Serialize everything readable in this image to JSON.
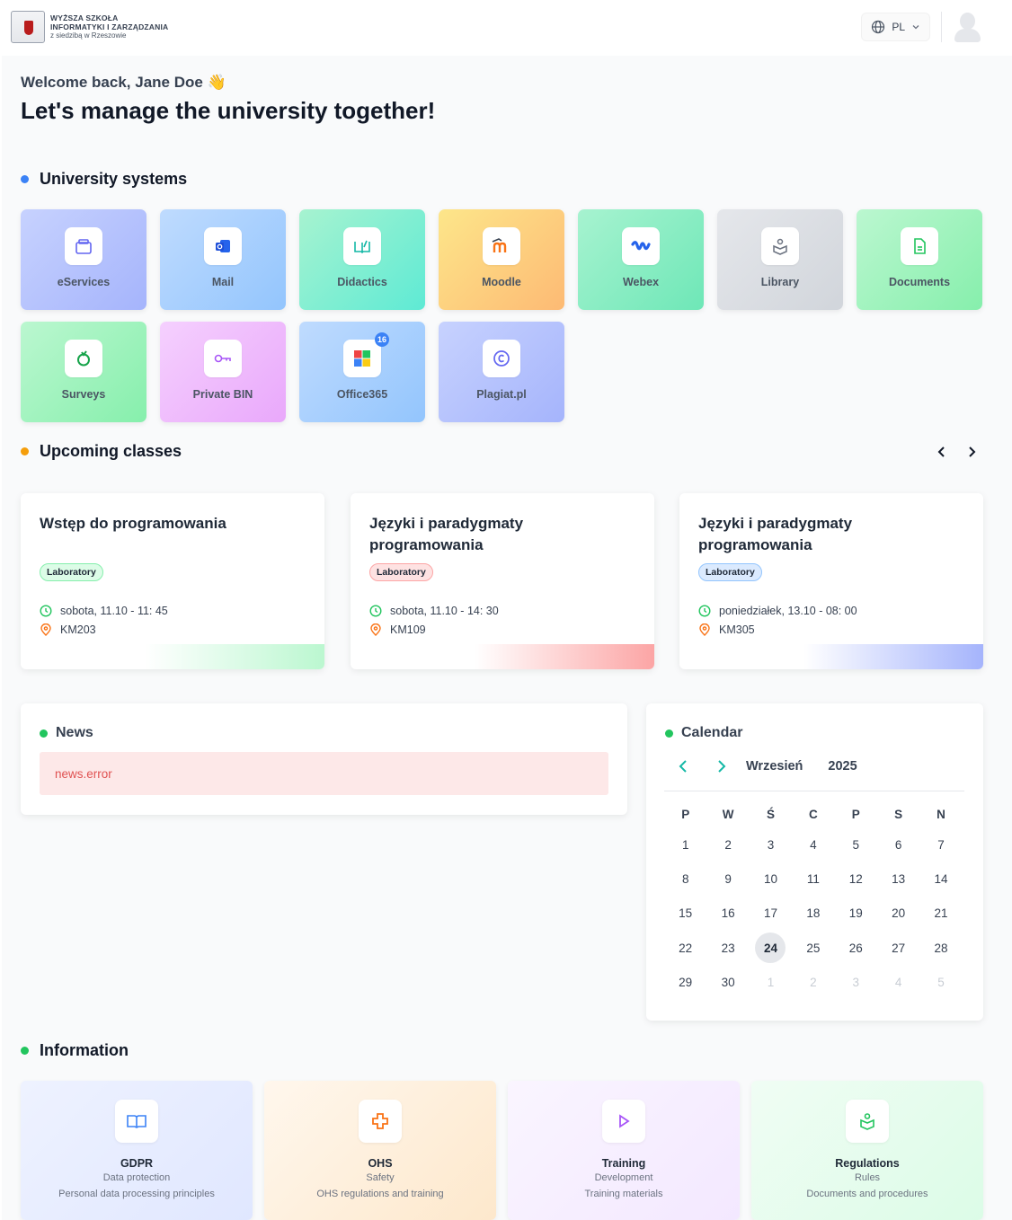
{
  "header": {
    "logo_line1": "WYŻSZA SZKOŁA",
    "logo_line2": "INFORMATYKI I ZARZĄDZANIA",
    "logo_line3": "z siedzibą w Rzeszowie",
    "language": "PL"
  },
  "greeting": {
    "welcome": "Welcome back, Jane Doe 👋",
    "headline": "Let's manage the university together!"
  },
  "systems": {
    "title": "University systems",
    "items": [
      {
        "label": "eServices",
        "icon": "briefcase-icon"
      },
      {
        "label": "Mail",
        "icon": "outlook-icon"
      },
      {
        "label": "Didactics",
        "icon": "book-open-icon"
      },
      {
        "label": "Moodle",
        "icon": "moodle-icon"
      },
      {
        "label": "Webex",
        "icon": "webex-icon"
      },
      {
        "label": "Library",
        "icon": "library-icon"
      },
      {
        "label": "Documents",
        "icon": "document-icon"
      },
      {
        "label": "Surveys",
        "icon": "survey-icon"
      },
      {
        "label": "Private BIN",
        "icon": "key-icon"
      },
      {
        "label": "Office365",
        "icon": "office-icon",
        "badge": "16"
      },
      {
        "label": "Plagiat.pl",
        "icon": "copyright-icon"
      }
    ]
  },
  "classes": {
    "title": "Upcoming classes",
    "items": [
      {
        "title": "Wstęp do programowania",
        "type": "Laboratory",
        "when": "sobota, 11.10 - 11: 45",
        "room": "KM203"
      },
      {
        "title": "Języki i paradygmaty programowania",
        "type": "Laboratory",
        "when": "sobota, 11.10 - 14: 30",
        "room": "KM109"
      },
      {
        "title": "Języki i paradygmaty programowania",
        "type": "Laboratory",
        "when": "poniedziałek, 13.10 - 08: 00",
        "room": "KM305"
      }
    ]
  },
  "news": {
    "title": "News",
    "error": "news.error"
  },
  "calendar": {
    "title": "Calendar",
    "month": "Wrzesień",
    "year": "2025",
    "day_names": [
      "P",
      "W",
      "Ś",
      "C",
      "P",
      "S",
      "N"
    ],
    "days": [
      "1",
      "2",
      "3",
      "4",
      "5",
      "6",
      "7",
      "8",
      "9",
      "10",
      "11",
      "12",
      "13",
      "14",
      "15",
      "16",
      "17",
      "18",
      "19",
      "20",
      "21",
      "22",
      "23",
      "24",
      "25",
      "26",
      "27",
      "28",
      "29",
      "30",
      "1",
      "2",
      "3",
      "4",
      "5"
    ],
    "today": "24"
  },
  "information": {
    "title": "Information",
    "items": [
      {
        "title": "GDPR",
        "subtitle": "Data protection",
        "desc": "Personal data processing principles"
      },
      {
        "title": "OHS",
        "subtitle": "Safety",
        "desc": "OHS regulations and training"
      },
      {
        "title": "Training",
        "subtitle": "Development",
        "desc": "Training materials"
      },
      {
        "title": "Regulations",
        "subtitle": "Rules",
        "desc": "Documents and procedures"
      }
    ]
  },
  "colors": {
    "blue_dot": "#3b82f6",
    "orange_dot": "#f59e0b",
    "green_dot": "#22c55e"
  }
}
